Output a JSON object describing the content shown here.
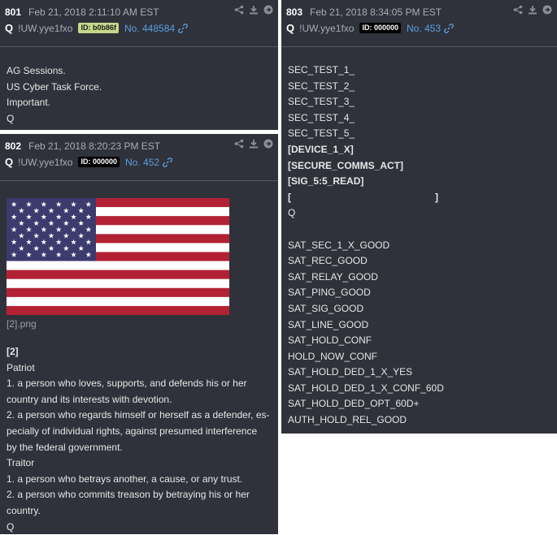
{
  "posts": [
    {
      "number": "801",
      "date": "Feb 21, 2018 2:11:10 AM EST",
      "name": "Q",
      "tripcode": "!UW.yye1fxo",
      "id_badge": "ID: b0b86f",
      "post_no": "No. 448584",
      "lines": [
        "AG Sessions.",
        "US Cyber Task Force.",
        "Important.",
        "Q"
      ]
    },
    {
      "number": "802",
      "date": "Feb 21, 2018 8:20:23 PM EST",
      "name": "Q",
      "tripcode": "!UW.yye1fxo",
      "id_badge": "ID: 000000",
      "post_no": "No. 452",
      "image_filename": "[2].png",
      "lines": [
        "[2]",
        "Patriot",
        "1. a person who loves, supports, and defends his or her",
        "country and its interests with devotion.",
        "2. a person who regards himself or herself as a defender, es-",
        "pecially of individual rights, against presumed interference",
        "by the federal government.",
        "Traitor",
        "1. a person who betrays another, a cause, or any trust.",
        "2. a person who commits treason by betraying his or her",
        "country.",
        "Q"
      ]
    },
    {
      "number": "803",
      "date": "Feb 21, 2018 8:34:05 PM EST",
      "name": "Q",
      "tripcode": "!UW.yye1fxo",
      "id_badge": "ID: 000000",
      "post_no": "No. 453",
      "lines": [
        "SEC_TEST_1_",
        "SEC_TEST_2_",
        "SEC_TEST_3_",
        "SEC_TEST_4_",
        "SEC_TEST_5_",
        "[DEVICE_1_X]",
        "[SECURE_COMMS_ACT]",
        "[SIG_5:5_READ]",
        "[",
        "]",
        "Q",
        "SAT_SEC_1_X_GOOD",
        "SAT_REC_GOOD",
        "SAT_RELAY_GOOD",
        "SAT_PING_GOOD",
        "SAT_SIG_GOOD",
        "SAT_LINE_GOOD",
        "SAT_HOLD_CONF",
        "HOLD_NOW_CONF",
        "SAT_HOLD_DED_1_X_YES",
        "SAT_HOLD_DED_1_X_CONF_60D",
        "SAT_HOLD_DED_OPT_60D+",
        "AUTH_HOLD_REL_GOOD"
      ]
    }
  ],
  "icons": [
    "share-icon",
    "download-icon",
    "forward-icon",
    "link-icon"
  ],
  "colors": {
    "panel": "#2f323a",
    "link": "#5b9ee0",
    "id_badge_green": "#c6d98a",
    "flag_red": "#b22234",
    "flag_blue": "#3c3b6e"
  }
}
